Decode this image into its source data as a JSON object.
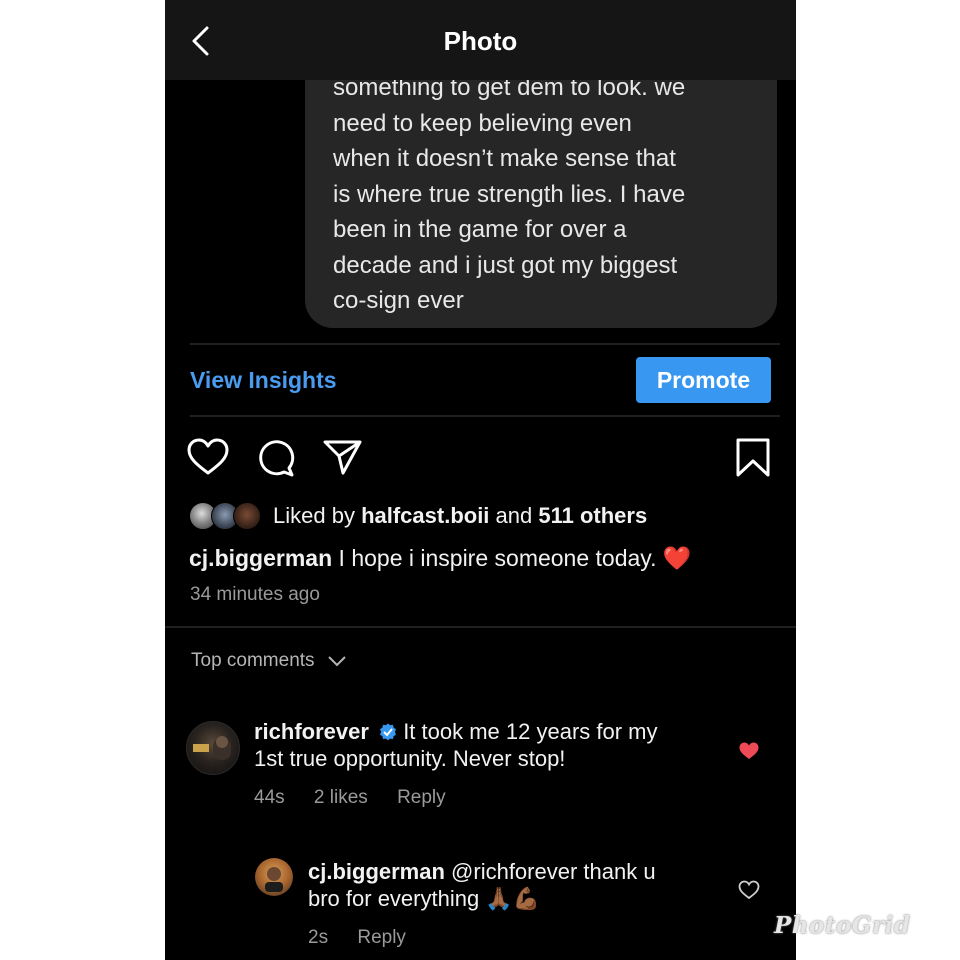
{
  "header": {
    "title": "Photo"
  },
  "post_text": {
    "lines": [
      "something to get dem to look. we",
      "need to keep believing even",
      "when it doesn’t make sense that",
      "is where true strength lies. I have",
      "been in the game for over a",
      "decade and i just got my biggest",
      "co-sign ever"
    ]
  },
  "insights": {
    "view_label": "View Insights",
    "promote_label": "Promote"
  },
  "actions": {
    "icons": [
      "heart-icon",
      "comment-icon",
      "share-icon",
      "bookmark-icon"
    ]
  },
  "likes": {
    "prefix": "Liked by ",
    "user": "halfcast.boii",
    "middle": " and ",
    "others": "511 others"
  },
  "caption": {
    "username": "cj.biggerman",
    "text": " I hope i inspire someone today. ❤️",
    "time": "34 minutes ago"
  },
  "comments_header": "Top comments",
  "comments": [
    {
      "username": "richforever",
      "verified": true,
      "line1": " It took me 12 years for my",
      "line2": "1st true opportunity. Never stop!",
      "time": "44s",
      "likes": "2 likes",
      "reply_label": "Reply",
      "liked": true
    },
    {
      "username": "cj.biggerman",
      "line1": " @richforever thank u",
      "line2": "bro for everything 🙏🏾💪🏾",
      "time": "2s",
      "reply_label": "Reply",
      "liked": false
    }
  ],
  "watermark": "PhotoGrid",
  "colors": {
    "accent": "#3897f0",
    "link": "#4a9cf0",
    "like_red": "#ed4956",
    "background": "#000000",
    "bubble": "#262626"
  }
}
